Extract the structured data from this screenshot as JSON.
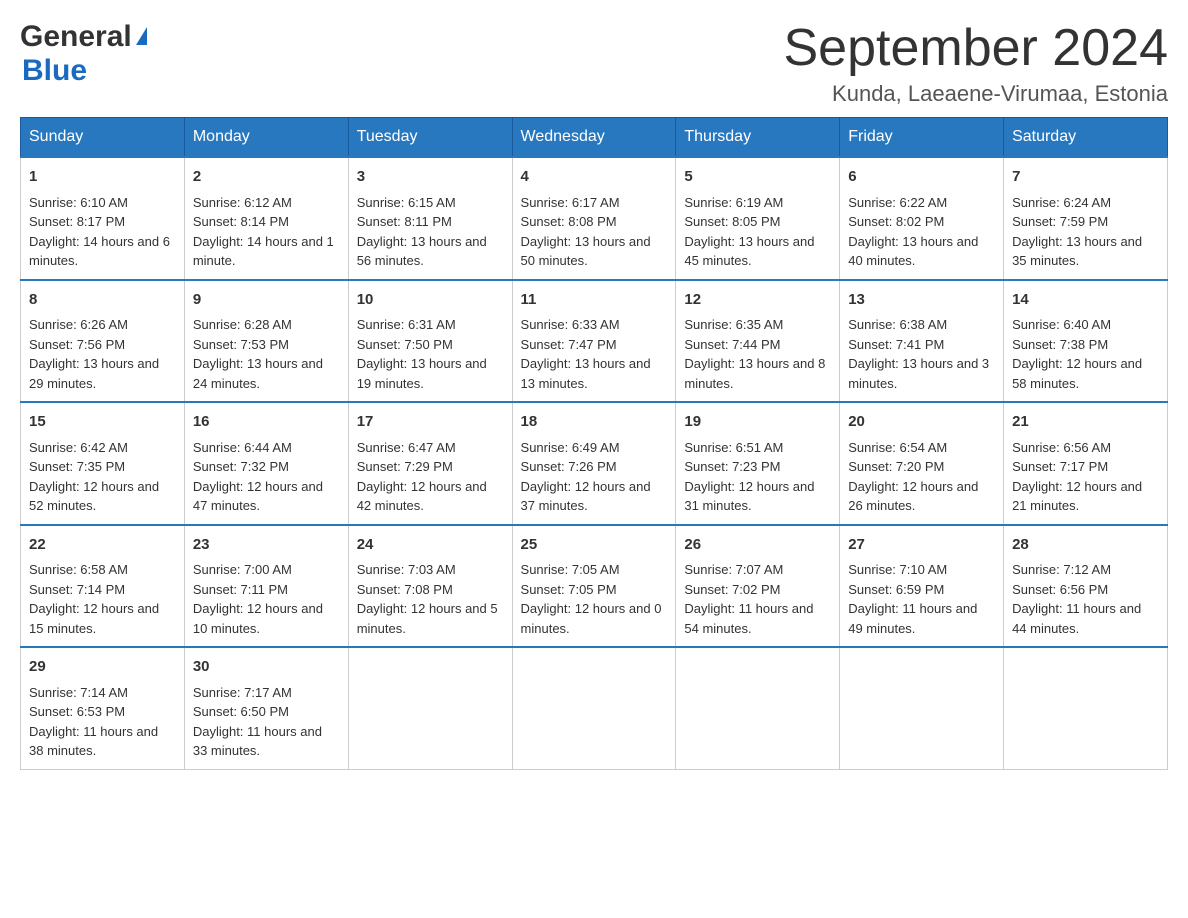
{
  "header": {
    "month_title": "September 2024",
    "location": "Kunda, Laeaene-Virumaa, Estonia",
    "logo_line1": "General",
    "logo_line2": "Blue"
  },
  "days_of_week": [
    "Sunday",
    "Monday",
    "Tuesday",
    "Wednesday",
    "Thursday",
    "Friday",
    "Saturday"
  ],
  "weeks": [
    [
      {
        "day": "1",
        "sunrise": "Sunrise: 6:10 AM",
        "sunset": "Sunset: 8:17 PM",
        "daylight": "Daylight: 14 hours and 6 minutes."
      },
      {
        "day": "2",
        "sunrise": "Sunrise: 6:12 AM",
        "sunset": "Sunset: 8:14 PM",
        "daylight": "Daylight: 14 hours and 1 minute."
      },
      {
        "day": "3",
        "sunrise": "Sunrise: 6:15 AM",
        "sunset": "Sunset: 8:11 PM",
        "daylight": "Daylight: 13 hours and 56 minutes."
      },
      {
        "day": "4",
        "sunrise": "Sunrise: 6:17 AM",
        "sunset": "Sunset: 8:08 PM",
        "daylight": "Daylight: 13 hours and 50 minutes."
      },
      {
        "day": "5",
        "sunrise": "Sunrise: 6:19 AM",
        "sunset": "Sunset: 8:05 PM",
        "daylight": "Daylight: 13 hours and 45 minutes."
      },
      {
        "day": "6",
        "sunrise": "Sunrise: 6:22 AM",
        "sunset": "Sunset: 8:02 PM",
        "daylight": "Daylight: 13 hours and 40 minutes."
      },
      {
        "day": "7",
        "sunrise": "Sunrise: 6:24 AM",
        "sunset": "Sunset: 7:59 PM",
        "daylight": "Daylight: 13 hours and 35 minutes."
      }
    ],
    [
      {
        "day": "8",
        "sunrise": "Sunrise: 6:26 AM",
        "sunset": "Sunset: 7:56 PM",
        "daylight": "Daylight: 13 hours and 29 minutes."
      },
      {
        "day": "9",
        "sunrise": "Sunrise: 6:28 AM",
        "sunset": "Sunset: 7:53 PM",
        "daylight": "Daylight: 13 hours and 24 minutes."
      },
      {
        "day": "10",
        "sunrise": "Sunrise: 6:31 AM",
        "sunset": "Sunset: 7:50 PM",
        "daylight": "Daylight: 13 hours and 19 minutes."
      },
      {
        "day": "11",
        "sunrise": "Sunrise: 6:33 AM",
        "sunset": "Sunset: 7:47 PM",
        "daylight": "Daylight: 13 hours and 13 minutes."
      },
      {
        "day": "12",
        "sunrise": "Sunrise: 6:35 AM",
        "sunset": "Sunset: 7:44 PM",
        "daylight": "Daylight: 13 hours and 8 minutes."
      },
      {
        "day": "13",
        "sunrise": "Sunrise: 6:38 AM",
        "sunset": "Sunset: 7:41 PM",
        "daylight": "Daylight: 13 hours and 3 minutes."
      },
      {
        "day": "14",
        "sunrise": "Sunrise: 6:40 AM",
        "sunset": "Sunset: 7:38 PM",
        "daylight": "Daylight: 12 hours and 58 minutes."
      }
    ],
    [
      {
        "day": "15",
        "sunrise": "Sunrise: 6:42 AM",
        "sunset": "Sunset: 7:35 PM",
        "daylight": "Daylight: 12 hours and 52 minutes."
      },
      {
        "day": "16",
        "sunrise": "Sunrise: 6:44 AM",
        "sunset": "Sunset: 7:32 PM",
        "daylight": "Daylight: 12 hours and 47 minutes."
      },
      {
        "day": "17",
        "sunrise": "Sunrise: 6:47 AM",
        "sunset": "Sunset: 7:29 PM",
        "daylight": "Daylight: 12 hours and 42 minutes."
      },
      {
        "day": "18",
        "sunrise": "Sunrise: 6:49 AM",
        "sunset": "Sunset: 7:26 PM",
        "daylight": "Daylight: 12 hours and 37 minutes."
      },
      {
        "day": "19",
        "sunrise": "Sunrise: 6:51 AM",
        "sunset": "Sunset: 7:23 PM",
        "daylight": "Daylight: 12 hours and 31 minutes."
      },
      {
        "day": "20",
        "sunrise": "Sunrise: 6:54 AM",
        "sunset": "Sunset: 7:20 PM",
        "daylight": "Daylight: 12 hours and 26 minutes."
      },
      {
        "day": "21",
        "sunrise": "Sunrise: 6:56 AM",
        "sunset": "Sunset: 7:17 PM",
        "daylight": "Daylight: 12 hours and 21 minutes."
      }
    ],
    [
      {
        "day": "22",
        "sunrise": "Sunrise: 6:58 AM",
        "sunset": "Sunset: 7:14 PM",
        "daylight": "Daylight: 12 hours and 15 minutes."
      },
      {
        "day": "23",
        "sunrise": "Sunrise: 7:00 AM",
        "sunset": "Sunset: 7:11 PM",
        "daylight": "Daylight: 12 hours and 10 minutes."
      },
      {
        "day": "24",
        "sunrise": "Sunrise: 7:03 AM",
        "sunset": "Sunset: 7:08 PM",
        "daylight": "Daylight: 12 hours and 5 minutes."
      },
      {
        "day": "25",
        "sunrise": "Sunrise: 7:05 AM",
        "sunset": "Sunset: 7:05 PM",
        "daylight": "Daylight: 12 hours and 0 minutes."
      },
      {
        "day": "26",
        "sunrise": "Sunrise: 7:07 AM",
        "sunset": "Sunset: 7:02 PM",
        "daylight": "Daylight: 11 hours and 54 minutes."
      },
      {
        "day": "27",
        "sunrise": "Sunrise: 7:10 AM",
        "sunset": "Sunset: 6:59 PM",
        "daylight": "Daylight: 11 hours and 49 minutes."
      },
      {
        "day": "28",
        "sunrise": "Sunrise: 7:12 AM",
        "sunset": "Sunset: 6:56 PM",
        "daylight": "Daylight: 11 hours and 44 minutes."
      }
    ],
    [
      {
        "day": "29",
        "sunrise": "Sunrise: 7:14 AM",
        "sunset": "Sunset: 6:53 PM",
        "daylight": "Daylight: 11 hours and 38 minutes."
      },
      {
        "day": "30",
        "sunrise": "Sunrise: 7:17 AM",
        "sunset": "Sunset: 6:50 PM",
        "daylight": "Daylight: 11 hours and 33 minutes."
      },
      null,
      null,
      null,
      null,
      null
    ]
  ]
}
